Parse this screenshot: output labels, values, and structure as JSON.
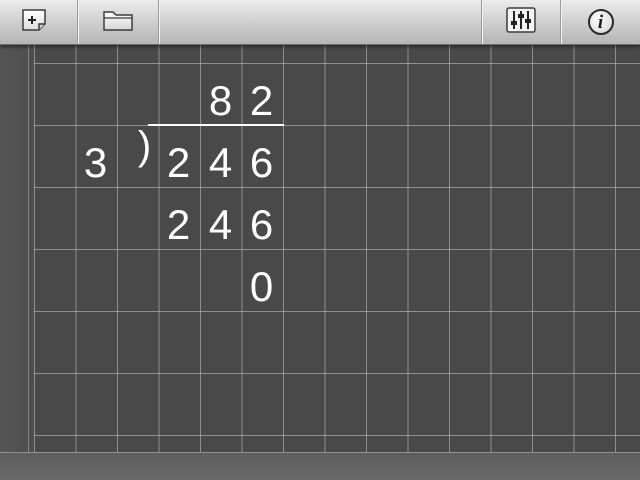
{
  "toolbar": {
    "buttons": [
      {
        "id": "new-sheet",
        "icon": "new-sheet-icon"
      },
      {
        "id": "open-folder",
        "icon": "folder-icon"
      },
      {
        "id": "settings",
        "icon": "sliders-icon"
      },
      {
        "id": "info",
        "icon": "info-icon",
        "glyph": "i"
      }
    ]
  },
  "problem": {
    "quotient": [
      "8",
      "2"
    ],
    "divisor": "3",
    "bracket": ")",
    "dividend": [
      "2",
      "4",
      "6"
    ],
    "subtract": [
      "2",
      "4",
      "6"
    ],
    "remainder": "0"
  },
  "colors": {
    "paper": "#494949",
    "grid_line": "#c8c8c8",
    "digits": "#ffffff",
    "toolbar": "#d0d0d0"
  }
}
